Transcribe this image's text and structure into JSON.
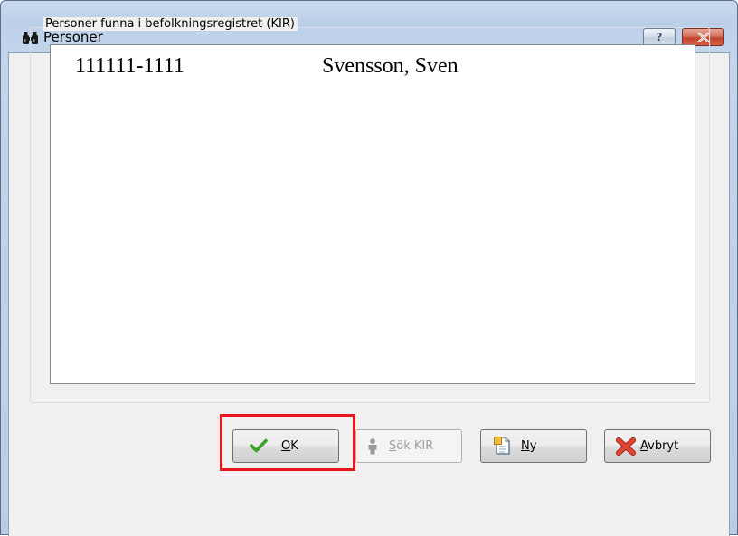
{
  "window": {
    "title": "Personer",
    "help_label": "?",
    "icons": {
      "app": "binoculars-icon",
      "help": "question-icon",
      "close": "close-icon"
    }
  },
  "group": {
    "label": "Personer funna i befolkningsregistret (KIR)"
  },
  "list": {
    "rows": [
      {
        "pnr": "111111-1111",
        "name": "Svensson, Sven"
      }
    ]
  },
  "buttons": {
    "ok": {
      "mnemonic": "O",
      "rest": "K",
      "icon": "checkmark-icon",
      "enabled": true
    },
    "sok_kir": {
      "mnemonic": "S",
      "rest": "ök KIR",
      "icon": "person-icon",
      "enabled": false
    },
    "ny": {
      "mnemonic": "N",
      "rest": "y",
      "icon": "new-document-icon",
      "enabled": true
    },
    "avbryt": {
      "mnemonic": "A",
      "rest": "vbryt",
      "icon": "cancel-x-icon",
      "enabled": true
    }
  },
  "colors": {
    "highlight": "#e8141e",
    "title_bar": "#c4d6ec",
    "close_button": "#c2432b",
    "ok_check": "#3aa02a",
    "cancel_x": "#d5392b"
  }
}
